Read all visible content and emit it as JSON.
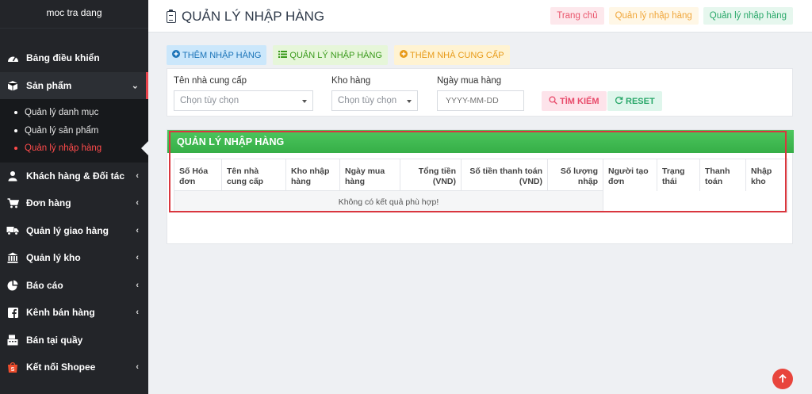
{
  "sidebar": {
    "brand": "moc tra dang",
    "items": [
      {
        "label": "Bảng điều khiển",
        "icon": "dashboard-icon",
        "chevron": ""
      },
      {
        "label": "Sản phẩm",
        "icon": "box-icon",
        "chevron": "⌄"
      },
      {
        "label": "Khách hàng & Đối tác",
        "icon": "user-icon",
        "chevron": "‹"
      },
      {
        "label": "Đơn hàng",
        "icon": "cart-icon",
        "chevron": "‹"
      },
      {
        "label": "Quản lý giao hàng",
        "icon": "truck-icon",
        "chevron": "‹"
      },
      {
        "label": "Quản lý kho",
        "icon": "bank-icon",
        "chevron": "‹"
      },
      {
        "label": "Báo cáo",
        "icon": "pie-chart-icon",
        "chevron": "‹"
      },
      {
        "label": "Kênh bán hàng",
        "icon": "facebook-icon",
        "chevron": "‹"
      },
      {
        "label": "Bán tại quầy",
        "icon": "register-icon",
        "chevron": ""
      },
      {
        "label": "Kết nối Shopee",
        "icon": "shopee-icon",
        "chevron": "‹"
      }
    ],
    "submenu": [
      {
        "label": "Quản lý danh mục"
      },
      {
        "label": "Quản lý sản phẩm"
      },
      {
        "label": "Quản lý nhập hàng"
      }
    ]
  },
  "header": {
    "title": "QUẢN LÝ NHẬP HÀNG",
    "breadcrumbs": [
      "Trang chủ",
      "Quản lý nhập hàng",
      "Quản lý nhập hàng"
    ]
  },
  "actions": [
    {
      "label": "THÊM NHẬP HÀNG",
      "icon": "plus-circle-icon"
    },
    {
      "label": "QUẢN LÝ NHẬP HÀNG",
      "icon": "list-icon"
    },
    {
      "label": "THÊM NHÀ CUNG CẤP",
      "icon": "plus-circle-icon"
    }
  ],
  "filters": {
    "supplier_label": "Tên nhà cung cấp",
    "supplier_value": "Chọn tùy chọn",
    "warehouse_label": "Kho hàng",
    "warehouse_value": "Chọn tùy chọn",
    "date_label": "Ngày mua hàng",
    "date_placeholder": "YYYY-MM-DD",
    "search_button": "TÌM KIẾM",
    "reset_button": "RESET"
  },
  "results": {
    "title": "QUẢN LÝ NHẬP HÀNG",
    "columns": [
      "Số Hóa đơn",
      "Tên nhà cung cấp",
      "Kho nhập hàng",
      "Ngày mua hàng",
      "Tổng tiền (VND)",
      "Số tiền thanh toán (VND)",
      "Số lượng nhập",
      "Người tạo đơn",
      "Trạng thái",
      "Thanh toán",
      "Nhập kho"
    ],
    "empty_message": "Không có kết quả phù hợp!"
  },
  "colors": {
    "sidebar_bg": "#232529",
    "accent_red": "#e8434b",
    "header_green": "#3db84f",
    "highlight_box": "#d9363e"
  }
}
